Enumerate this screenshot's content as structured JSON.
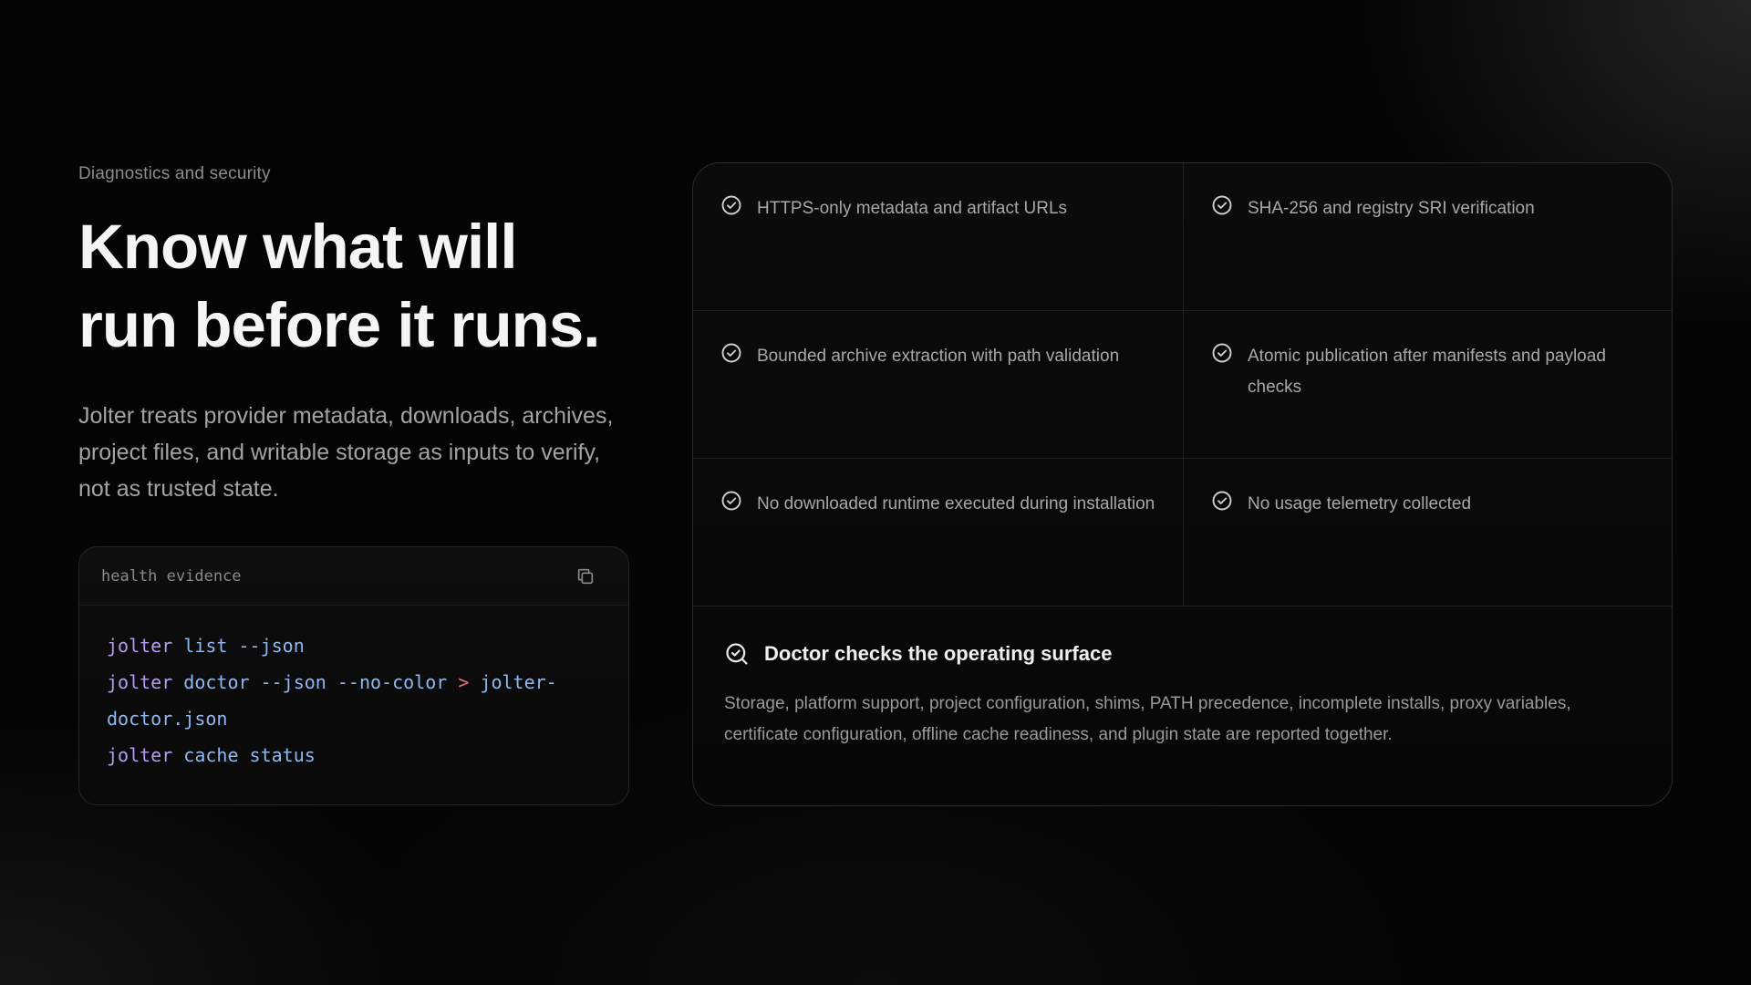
{
  "section": {
    "eyebrow": "Diagnostics and security",
    "headline_line1": "Know what will",
    "headline_line2": "run before it runs.",
    "lede": "Jolter treats provider metadata, downloads, archives, project files, and writable storage as inputs to verify, not as trusted state."
  },
  "code_card": {
    "title": "health evidence",
    "copy_icon": "copy-icon",
    "line1": {
      "cmd": "jolter",
      "rest": " list --json"
    },
    "line2": {
      "cmd": "jolter",
      "rest": " doctor --json --no-color ",
      "op": ">",
      "target": " jolter-"
    },
    "line3": {
      "rest": "doctor.json"
    },
    "line4": {
      "cmd": "jolter",
      "rest": " cache status"
    }
  },
  "features": {
    "icon": "check-circle-icon",
    "items": [
      {
        "label": "HTTPS-only metadata and artifact URLs"
      },
      {
        "label": "SHA-256 and registry SRI verification"
      },
      {
        "label": "Bounded archive extraction with path validation"
      },
      {
        "label": "Atomic publication after manifests and payload checks"
      },
      {
        "label": "No downloaded runtime executed during installation"
      },
      {
        "label": "No usage telemetry collected"
      }
    ]
  },
  "doctor": {
    "icon": "search-check-icon",
    "title": "Doctor checks the operating surface",
    "text": "Storage, platform support, project configuration, shims, PATH precedence, incomplete installs, proxy variables, certificate configuration, offline cache readiness, and plugin state are reported together."
  },
  "colors": {
    "background": "#040404",
    "code_command": "#b39cf0",
    "code_argument": "#8fb8f0",
    "code_operator": "#ef6f6f"
  }
}
